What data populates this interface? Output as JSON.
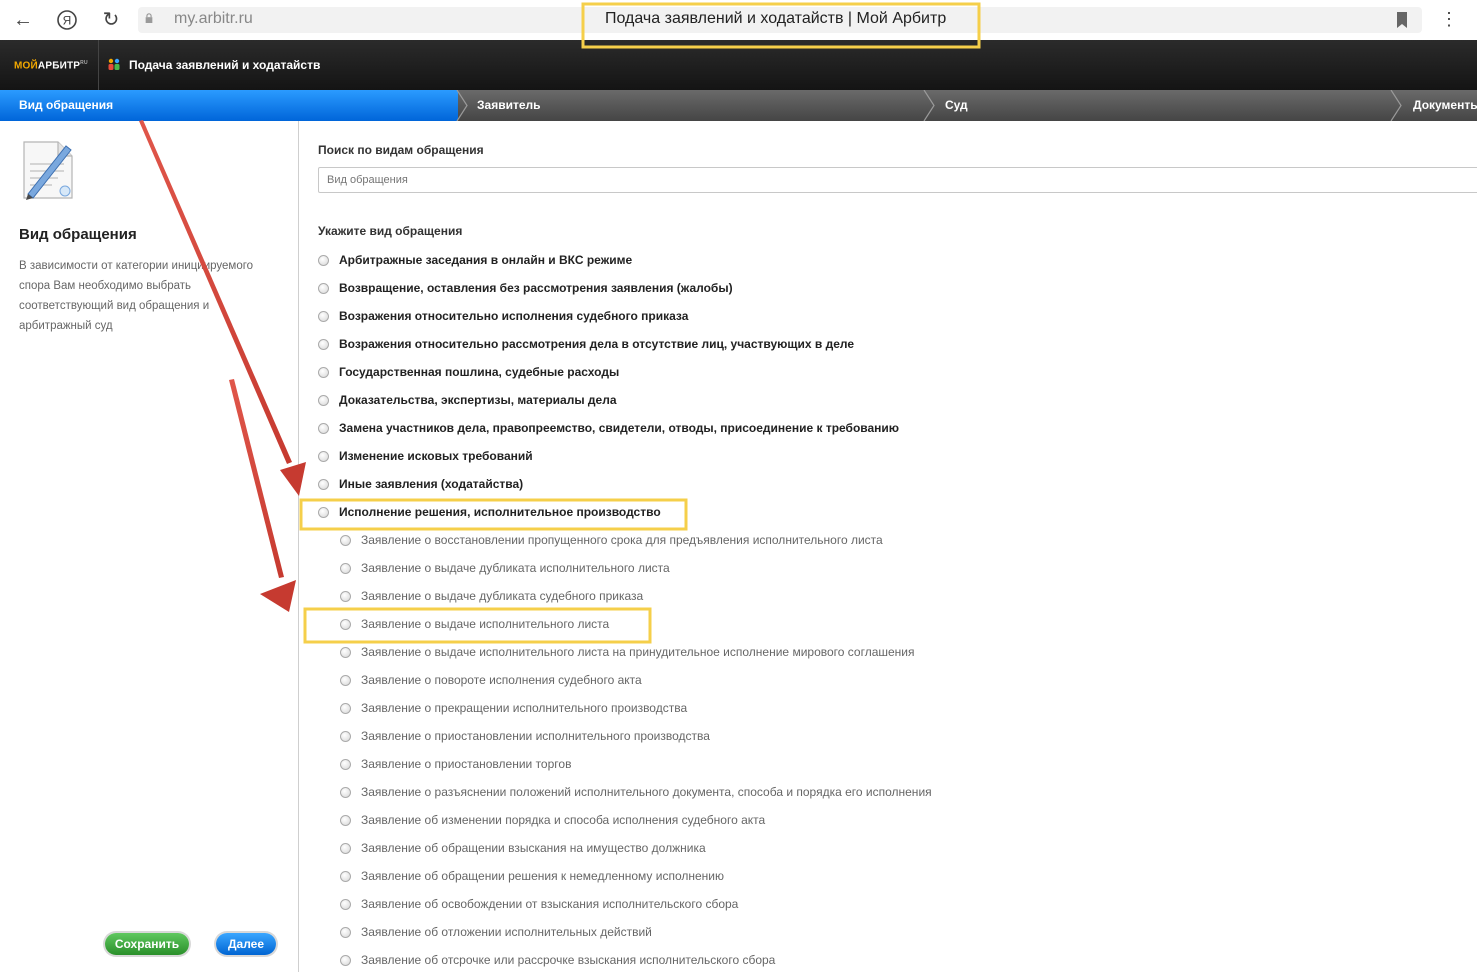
{
  "browser": {
    "url": "my.arbitr.ru",
    "tab_title": "Подача заявлений и ходатайств | Мой Арбитр"
  },
  "header": {
    "logo_part1": "МОЙ",
    "logo_part2": "АРБИТР",
    "logo_sup": "RU",
    "app_title": "Подача заявлений и ходатайств"
  },
  "steps": [
    "Вид обращения",
    "Заявитель",
    "Суд",
    "Документы"
  ],
  "sidebar": {
    "title": "Вид обращения",
    "description": "В зависимости от категории инициируемого спора Вам необходимо выбрать соответствующий вид обращения и арбитражный суд",
    "save_label": "Сохранить",
    "next_label": "Далее"
  },
  "search": {
    "label": "Поиск по видам обращения",
    "placeholder": "Вид обращения"
  },
  "options_label": "Укажите вид обращения",
  "options": [
    "Арбитражные заседания в онлайн и ВКС режиме",
    "Возвращение, оставления без рассмотрения заявления (жалобы)",
    "Возражения относительно исполнения судебного приказа",
    "Возражения относительно рассмотрения дела в отсутствие лиц, участвующих в деле",
    "Государственная пошлина, судебные расходы",
    "Доказательства, экспертизы, материалы дела",
    "Замена участников дела, правопреемство, свидетели, отводы, присоединение к требованию",
    "Изменение исковых требований",
    "Иные заявления (ходатайства)",
    "Исполнение решения, исполнительное производство"
  ],
  "sub_options": [
    "Заявление о восстановлении пропущенного срока для предъявления исполнительного листа",
    "Заявление о выдаче дубликата исполнительного листа",
    "Заявление о выдаче дубликата судебного приказа",
    "Заявление о выдаче исполнительного листа",
    "Заявление о выдаче исполнительного листа на принудительное исполнение мирового соглашения",
    "Заявление о повороте исполнения судебного акта",
    "Заявление о прекращении исполнительного производства",
    "Заявление о приостановлении исполнительного производства",
    "Заявление о приостановлении торгов",
    "Заявление о разъяснении положений исполнительного документа, способа и порядка его исполнения",
    "Заявление об изменении порядка и способа исполнения судебного акта",
    "Заявление об обращении взыскания на имущество должника",
    "Заявление об обращении решения к немедленному исполнению",
    "Заявление об освобождении от взыскания исполнительского сбора",
    "Заявление об отложении исполнительных действий",
    "Заявление об отсрочке или рассрочке взыскания исполнительского сбора"
  ],
  "colors": {
    "step_active": "#0a7ef0",
    "highlight": "#f5cf4a",
    "arrow": "#d8453a",
    "save_button": "#3aa53a",
    "next_button": "#0a7ef0"
  }
}
